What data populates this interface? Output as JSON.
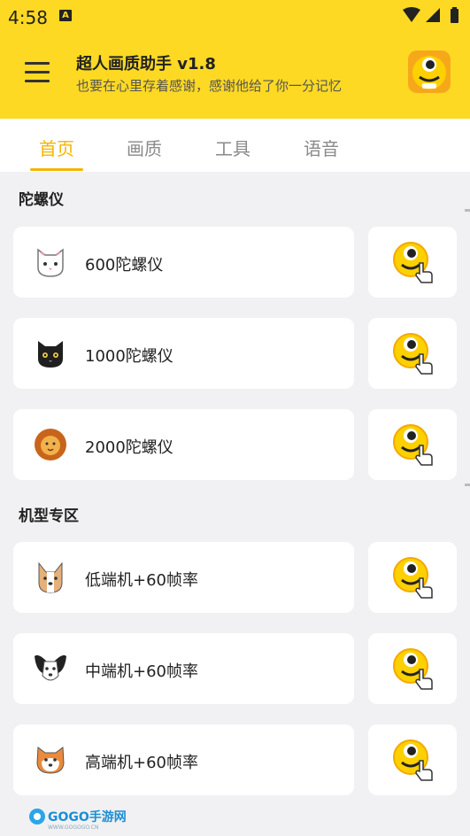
{
  "status_bar": {
    "time": "4:58",
    "notification_icon": "a-icon"
  },
  "header": {
    "title": "超人画质助手 v1.8",
    "subtitle": "也要在心里存着感谢，感谢他给了你一分记忆"
  },
  "tabs": [
    {
      "label": "首页",
      "active": true
    },
    {
      "label": "画质",
      "active": false
    },
    {
      "label": "工具",
      "active": false
    },
    {
      "label": "语音",
      "active": false
    }
  ],
  "sections": [
    {
      "title": "陀螺仪",
      "items": [
        {
          "label": "600陀螺仪",
          "icon": "white-cat-icon"
        },
        {
          "label": "1000陀螺仪",
          "icon": "black-cat-icon"
        },
        {
          "label": "2000陀螺仪",
          "icon": "lion-icon"
        }
      ]
    },
    {
      "title": "机型专区",
      "items": [
        {
          "label": "低端机+60帧率",
          "icon": "corgi-icon"
        },
        {
          "label": "中端机+60帧率",
          "icon": "papillon-dog-icon"
        },
        {
          "label": "高端机+60帧率",
          "icon": "shiba-icon"
        }
      ]
    }
  ],
  "watermark": {
    "text": "GOGO手游网",
    "url_text": "WWW.GOGOGO.CN"
  },
  "colors": {
    "accent": "#fdd923",
    "tab_active": "#f5b400"
  }
}
